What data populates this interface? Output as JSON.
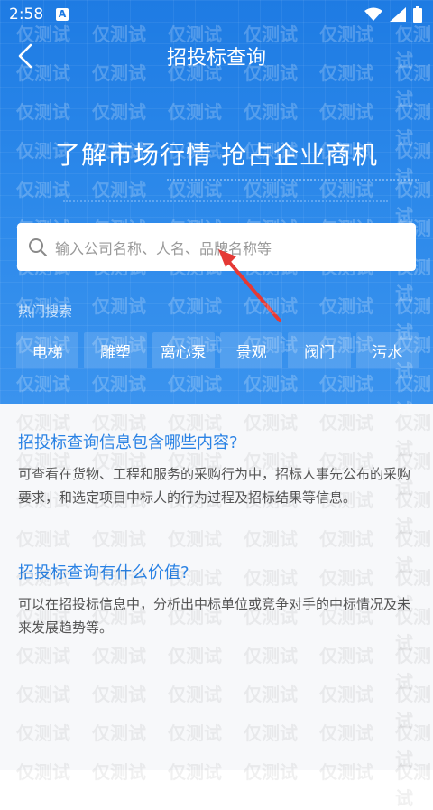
{
  "status": {
    "time": "2:58",
    "notification_letter": "A"
  },
  "header": {
    "title": "招投标查询",
    "back_icon": "chevron-left-icon"
  },
  "hero": {
    "slogan": "了解市场行情 抢占企业商机",
    "search_placeholder": "输入公司名称、人名、品牌名称等",
    "hot_label": "热门搜索",
    "hot_tags": [
      "电梯",
      "雕塑",
      "离心泵",
      "景观",
      "阀门",
      "污水"
    ]
  },
  "faq": [
    {
      "question": "招投标查询信息包含哪些内容?",
      "answer": "可查看在货物、工程和服务的采购行为中，招标人事先公布的采购要求，和选定项目中标人的行为过程及招标结果等信息。"
    },
    {
      "question": "招投标查询有什么价值?",
      "answer": "可以在招投标信息中，分析出中标单位或竞争对手的中标情况及未来发展趋势等。"
    }
  ],
  "watermark": "仅测试",
  "colors": {
    "brand_blue": "#1e7be3",
    "link_blue": "#2a82e4",
    "arrow_red": "#e53935"
  }
}
